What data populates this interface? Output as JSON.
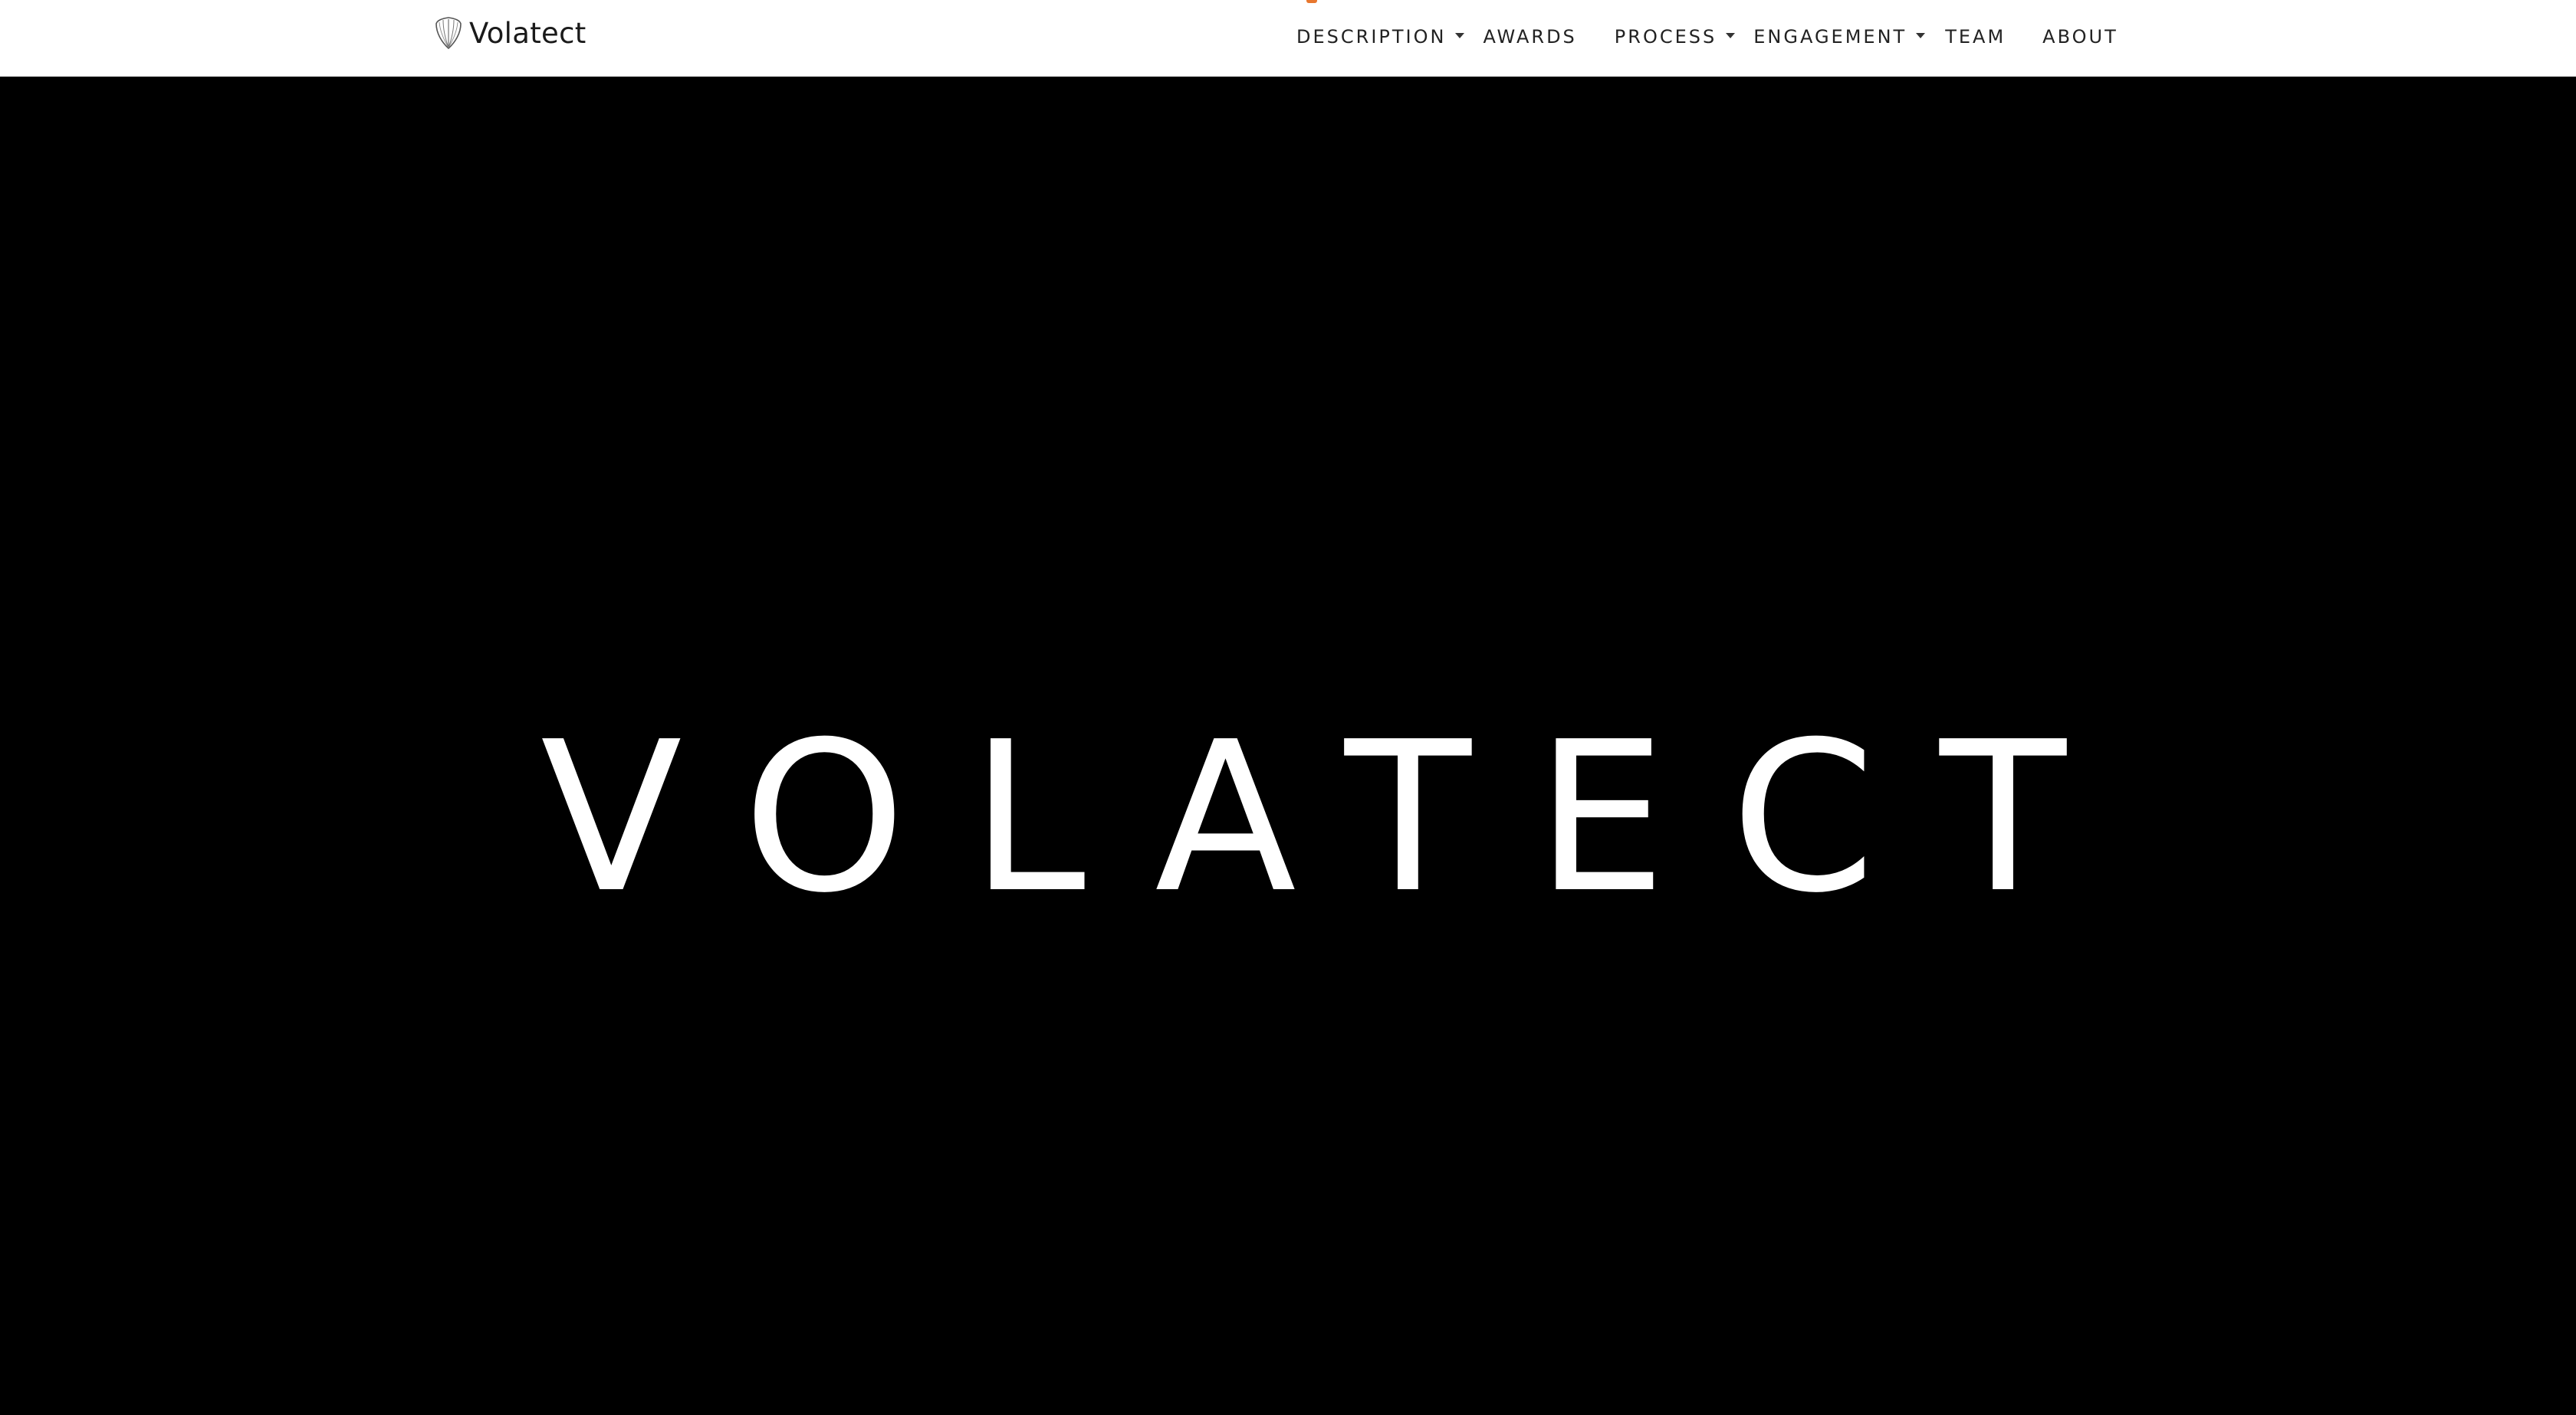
{
  "header": {
    "brand": {
      "name": "Volatect",
      "icon": "shield-leaf-logo-icon"
    },
    "nav": [
      {
        "label": "DESCRIPTION",
        "has_dropdown": true
      },
      {
        "label": "AWARDS",
        "has_dropdown": false
      },
      {
        "label": "PROCESS",
        "has_dropdown": true
      },
      {
        "label": "ENGAGEMENT",
        "has_dropdown": true
      },
      {
        "label": "TEAM",
        "has_dropdown": false
      },
      {
        "label": "ABOUT",
        "has_dropdown": false
      }
    ],
    "active_indicator_color": "#e8772e"
  },
  "hero": {
    "wordmark": "VOLATECT",
    "background_color": "#000000",
    "text_color": "#ffffff"
  }
}
